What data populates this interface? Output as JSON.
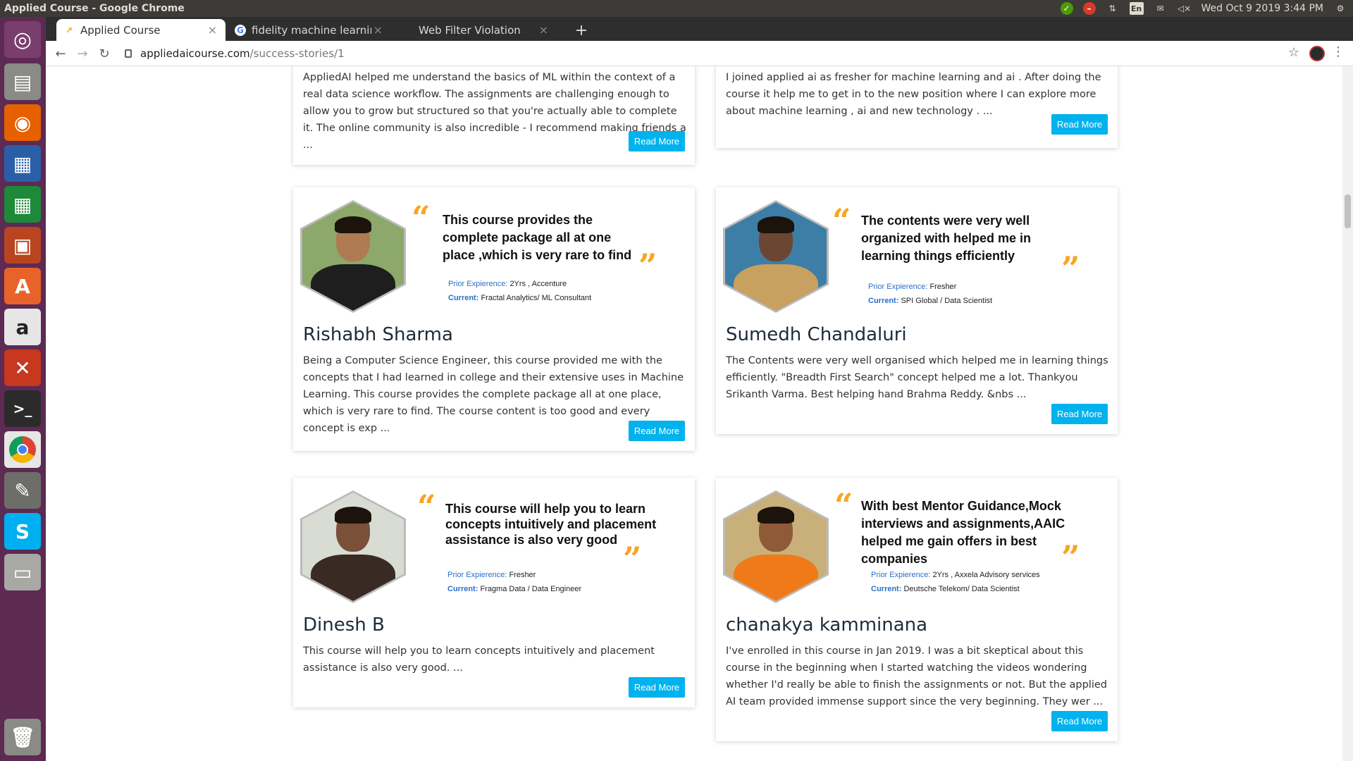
{
  "os": {
    "window_title": "Applied Course - Google Chrome",
    "clock": "Wed Oct  9 2019  3:44 PM",
    "keyboard_layout": "En"
  },
  "browser": {
    "tabs": [
      {
        "label": "Applied Course",
        "active": true
      },
      {
        "label": "fidelity machine learning",
        "active": false
      },
      {
        "label": "Web Filter Violation",
        "active": false
      }
    ],
    "url_host": "appliedaicourse.com",
    "url_path": "/success-stories/1"
  },
  "stories": {
    "top_left": {
      "excerpt": "AppliedAI helped me understand the basics of ML within the context of a real data science workflow. The assignments are challenging enough to allow you to grow but structured so that you're actually able to complete it. The online community is also incredible - I recommend making friends a ...",
      "button": "Read More"
    },
    "top_right": {
      "excerpt": "I joined applied ai as fresher for machine learning and ai . After doing the course it help me to get in to the new position where I can explore more about machine learning , ai and new technology .                   ...",
      "button": "Read More"
    },
    "cards": [
      {
        "quote": "This course provides the complete package all at one place ,which is very rare to find",
        "prior_label": "Prior Expierence:",
        "prior_value": "2Yrs , Accenture",
        "current_label": "Current:",
        "current_value": "Fractal Analytics/ ML Consultant",
        "name": "Rishabh Sharma",
        "excerpt": "Being a Computer Science Engineer, this course provided me with the concepts that I had learned in college and their extensive uses in Machine Learning. This course provides the complete package all at one place, which is very rare to find. The course content is too good and every concept is exp ...",
        "button": "Read More"
      },
      {
        "quote": "The contents were very well organized with helped me in learning things efficiently",
        "prior_label": "Prior Expierence:",
        "prior_value": "Fresher",
        "current_label": "Current:",
        "current_value": "SPI Global / Data Scientist",
        "name": "Sumedh Chandaluri",
        "excerpt": "The Contents were very well organised which helped me in learning things efficiently. \"Breadth First Search\" concept helped me a lot. Thankyou Srikanth Varma. Best helping hand Brahma Reddy.                 &nbs ...",
        "button": "Read More"
      },
      {
        "quote": "This course will help you to learn concepts intuitively and placement assistance is also very good",
        "prior_label": "Prior Expierence:",
        "prior_value": "Fresher",
        "current_label": "Current:",
        "current_value": "Fragma Data / Data Engineer",
        "name": "Dinesh B",
        "excerpt": "This course will help you to learn concepts intuitively and placement assistance is also very good.                               ...",
        "button": "Read More"
      },
      {
        "quote": "With best Mentor Guidance,Mock interviews and assignments,AAIC helped me gain offers in best companies",
        "prior_label": "Prior Expierence:",
        "prior_value": "2Yrs , Axxela Advisory services",
        "current_label": "Current:",
        "current_value": "Deutsche Telekom/ Data Scientist",
        "name": "chanakya kamminana",
        "excerpt": "I've enrolled in this course in Jan 2019. I was a bit skeptical about this course in the beginning when I started watching the videos wondering whether I'd really be able to finish the assignments or not. But the applied AI team provided immense support since the very beginning. They wer ...",
        "button": "Read More"
      }
    ]
  },
  "colors": {
    "accent": "#00b2ee",
    "quote_mark": "#f6a623",
    "launcher": "#5c2a53"
  }
}
